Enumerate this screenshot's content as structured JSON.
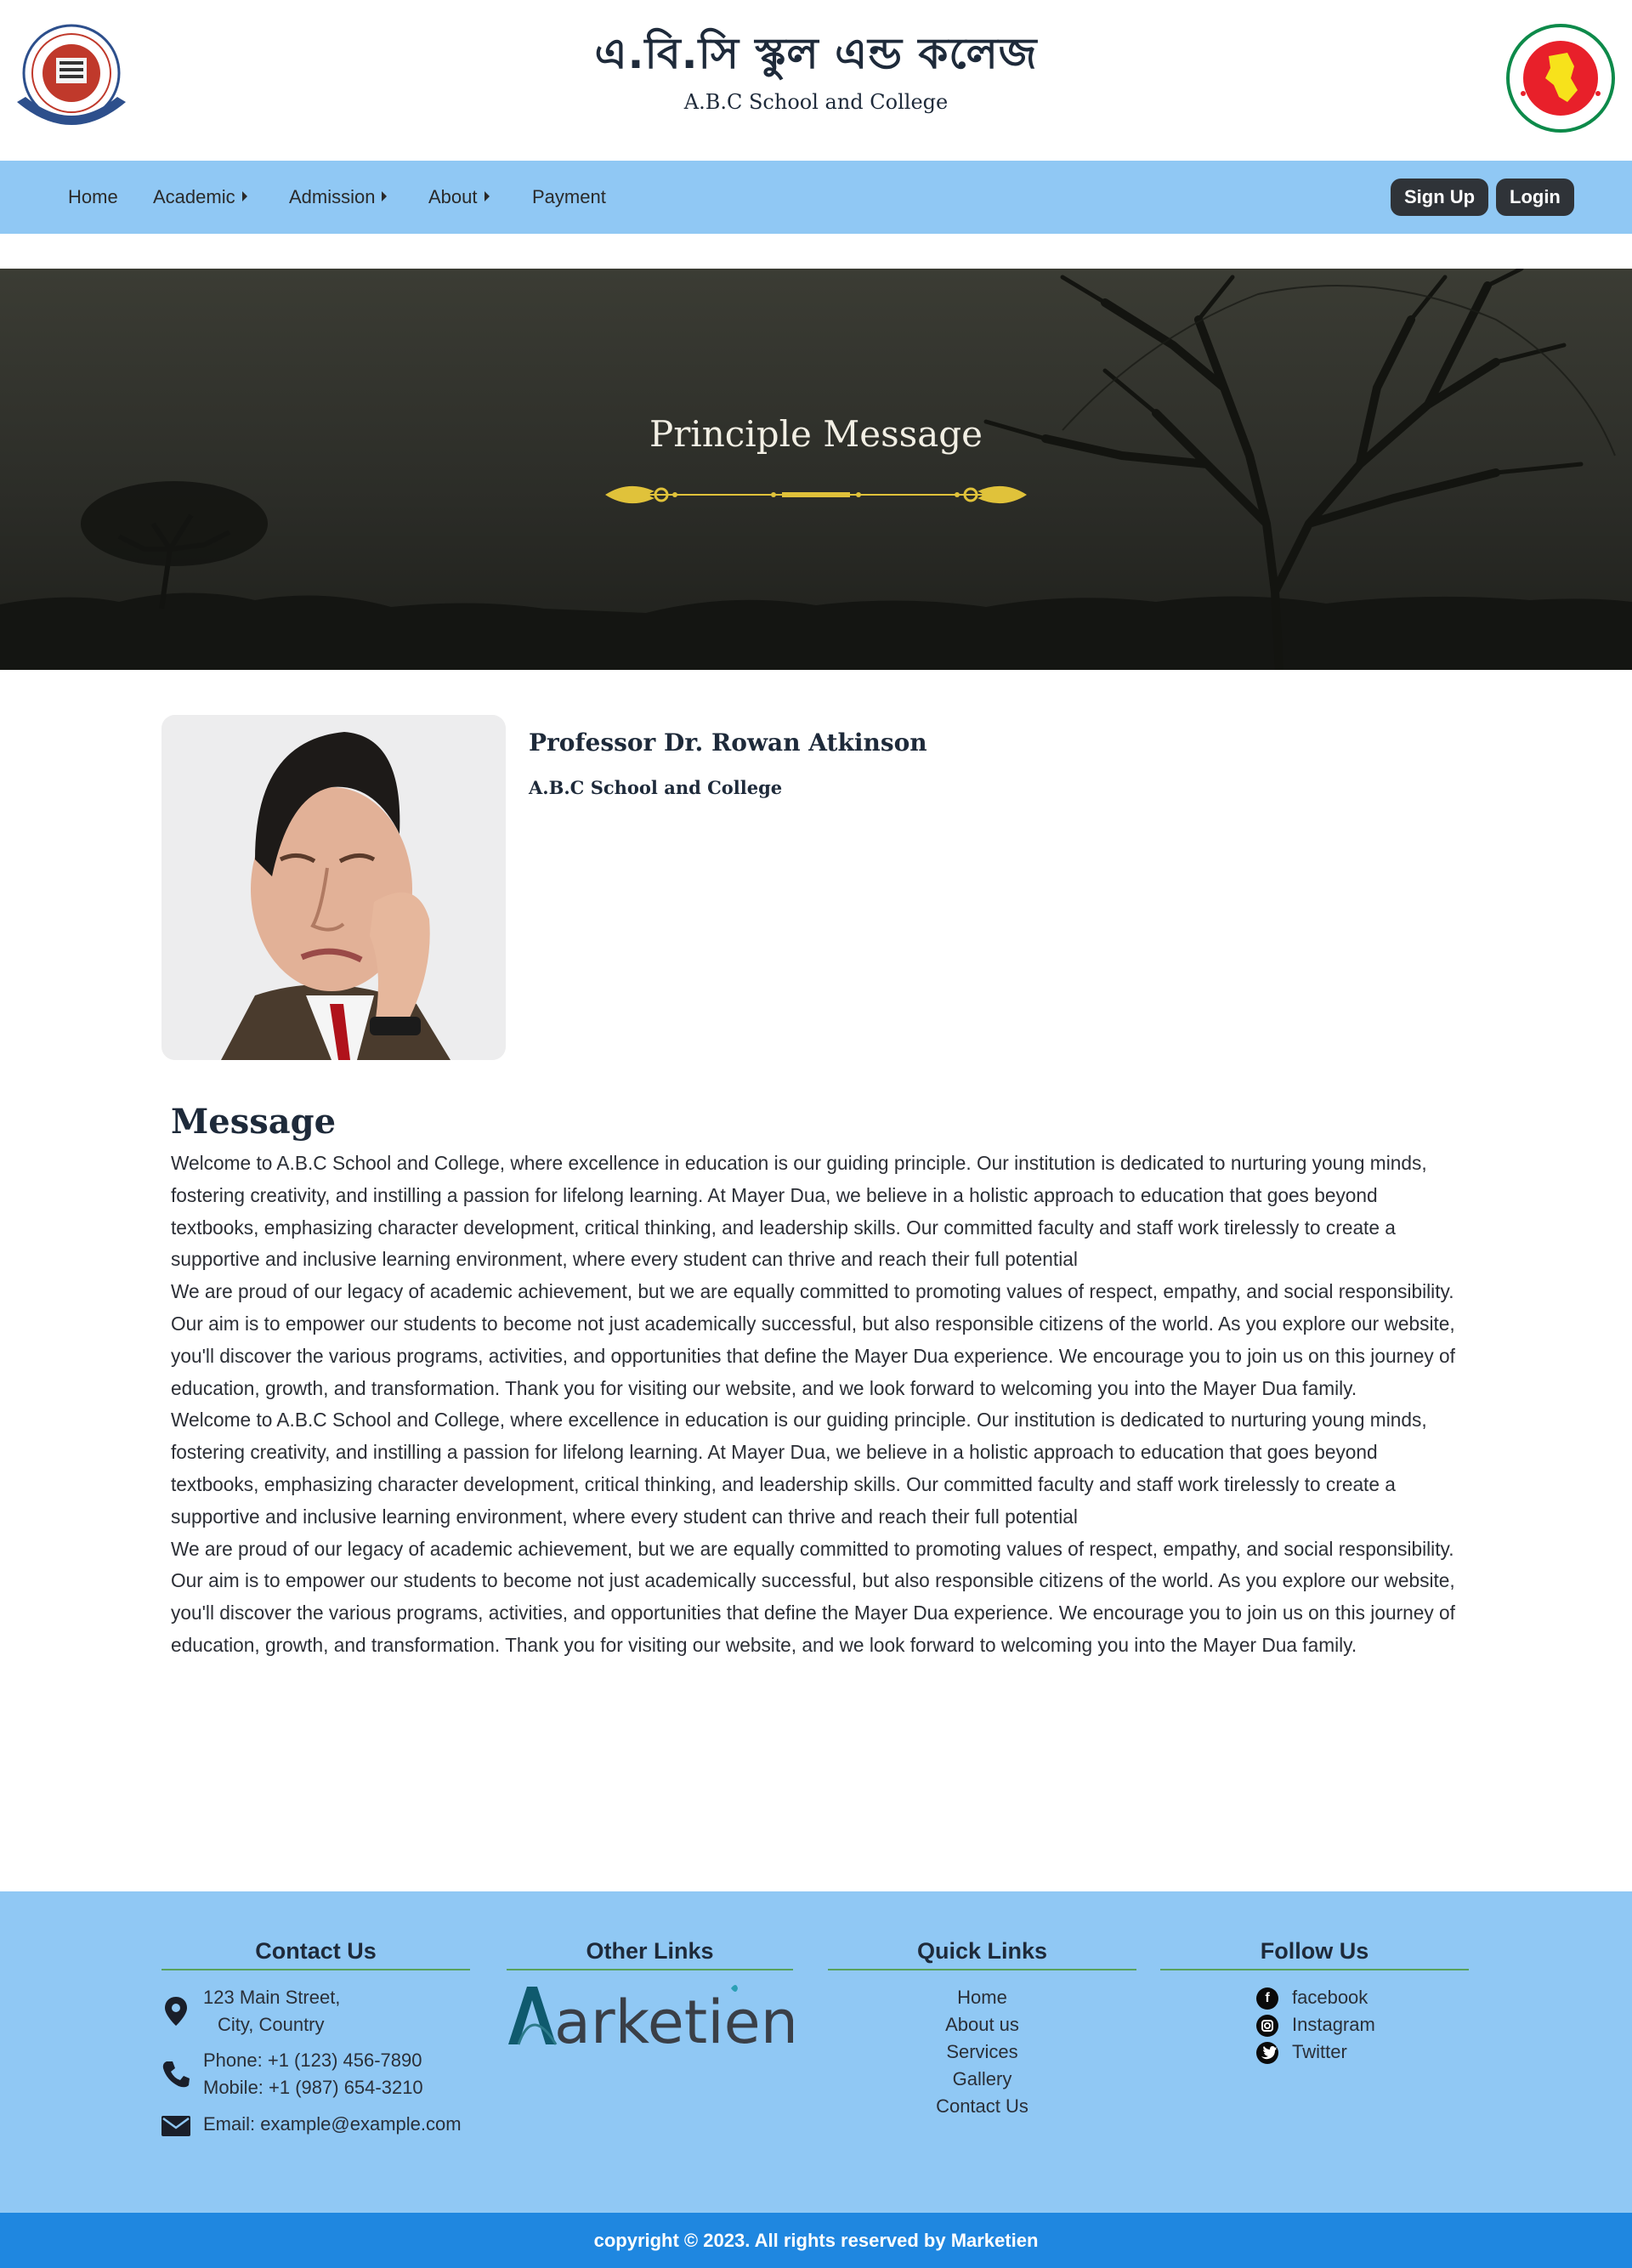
{
  "header": {
    "title_bn": "এ.বি.সি স্কুল এন্ড কলেজ",
    "title_en": "A.B.C School and College"
  },
  "nav": {
    "items": [
      {
        "label": "Home",
        "has_caret": false
      },
      {
        "label": "Academic",
        "has_caret": true
      },
      {
        "label": "Admission",
        "has_caret": true
      },
      {
        "label": "About",
        "has_caret": true
      },
      {
        "label": "Payment",
        "has_caret": false
      }
    ],
    "signup_label": "Sign Up",
    "login_label": "Login"
  },
  "hero": {
    "title": "Principle Message"
  },
  "profile": {
    "name": "Professor Dr. Rowan Atkinson",
    "school": "A.B.C School and College"
  },
  "message": {
    "title": "Message",
    "paragraphs": [
      "Welcome to A.B.C School and College, where excellence in education is our guiding principle. Our institution is dedicated to nurturing young minds, fostering creativity, and instilling a passion for lifelong learning. At Mayer Dua, we believe in a holistic approach to education that goes beyond textbooks, emphasizing character development, critical thinking, and leadership skills. Our committed faculty and staff work tirelessly to create a supportive and inclusive learning environment, where every student can thrive and reach their full potential",
      "We are proud of our legacy of academic achievement, but we are equally committed to promoting values of respect, empathy, and social responsibility. Our aim is to empower our students to become not just academically successful, but also responsible citizens of the world. As you explore our website, you'll discover the various programs, activities, and opportunities that define the Mayer Dua experience. We encourage you to join us on this journey of education, growth, and transformation. Thank you for visiting our website, and we look forward to welcoming you into the Mayer Dua family.",
      "Welcome to A.B.C School and College, where excellence in education is our guiding principle. Our institution is dedicated to nurturing young minds, fostering creativity, and instilling a passion for lifelong learning. At Mayer Dua, we believe in a holistic approach to education that goes beyond textbooks, emphasizing character development, critical thinking, and leadership skills. Our committed faculty and staff work tirelessly to create a supportive and inclusive learning environment, where every student can thrive and reach their full potential",
      "We are proud of our legacy of academic achievement, but we are equally committed to promoting values of respect, empathy, and social responsibility. Our aim is to empower our students to become not just academically successful, but also responsible citizens of the world. As you explore our website, you'll discover the various programs, activities, and opportunities that define the Mayer Dua experience. We encourage you to join us on this journey of education, growth, and transformation. Thank you for visiting our website, and we look forward to welcoming you into the Mayer Dua family."
    ]
  },
  "footer": {
    "contact": {
      "title": "Contact Us",
      "address_line1": "123 Main Street,",
      "address_line2": "City, Country",
      "phone": "Phone: +1 (123) 456-7890",
      "mobile": "Mobile: +1 (987) 654-3210",
      "email": "Email: example@example.com"
    },
    "other_links": {
      "title": "Other Links",
      "brand": "Marketien"
    },
    "quick_links": {
      "title": "Quick Links",
      "items": [
        "Home",
        "About us",
        "Services",
        "Gallery",
        "Contact Us"
      ]
    },
    "follow": {
      "title": "Follow Us",
      "items": [
        {
          "label": "facebook",
          "icon": "facebook-icon"
        },
        {
          "label": "Instagram",
          "icon": "instagram-icon"
        },
        {
          "label": "Twitter",
          "icon": "twitter-icon"
        }
      ]
    },
    "copyright": "copyright © 2023. All rights reserved by Marketien"
  },
  "colors": {
    "nav_bg": "#90c8f4",
    "button_bg": "#2f3338",
    "copyright_bg": "#1f87e0",
    "ornament": "#e0c23a"
  }
}
